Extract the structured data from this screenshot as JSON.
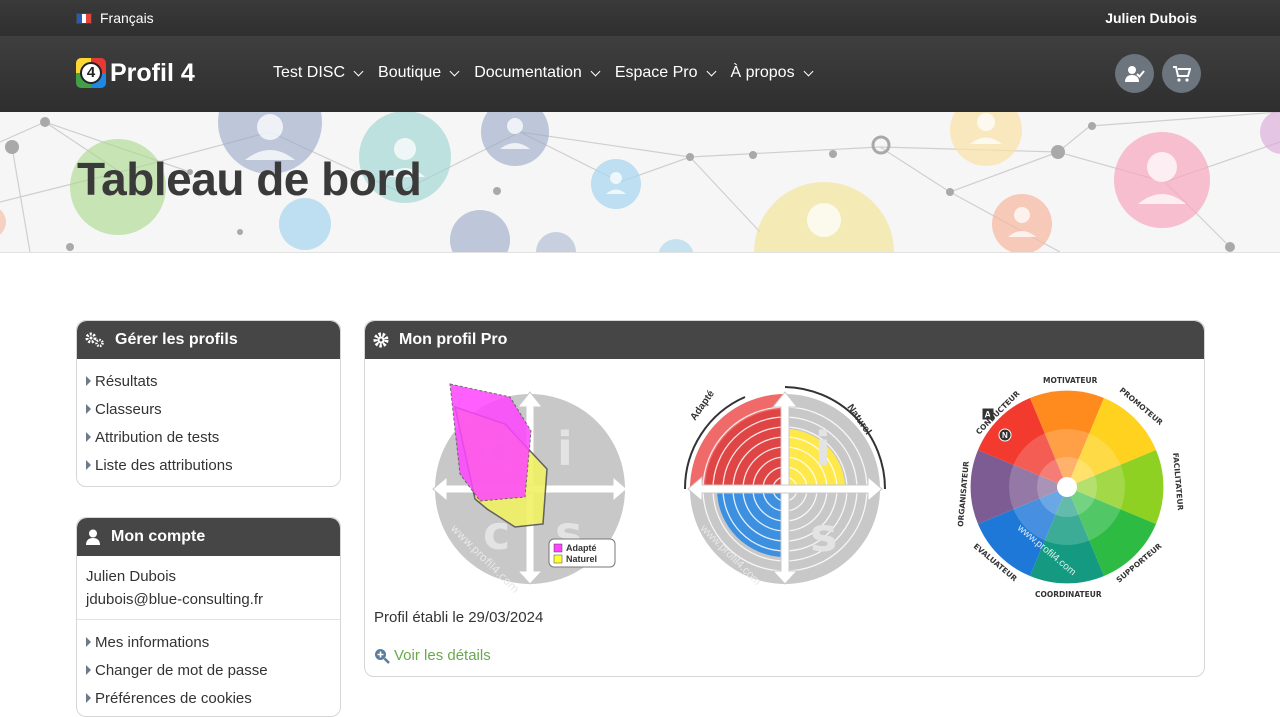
{
  "topbar": {
    "language": "Français",
    "user_name": "Julien Dubois"
  },
  "brand": {
    "logo_digit": "4",
    "name": "Profil 4"
  },
  "nav": {
    "items": [
      "Test DISC",
      "Boutique",
      "Documentation",
      "Espace Pro",
      "À propos"
    ]
  },
  "hero": {
    "title": "Tableau de bord"
  },
  "profiles_panel": {
    "title": "Gérer les profils",
    "items": [
      "Résultats",
      "Classeurs",
      "Attribution de tests",
      "Liste des attributions"
    ]
  },
  "account_panel": {
    "title": "Mon compte",
    "name": "Julien Dubois",
    "email": "jdubois@blue-consulting.fr",
    "items": [
      "Mes informations",
      "Changer de mot de passe",
      "Préférences de cookies"
    ]
  },
  "pro_panel": {
    "title": "Mon profil Pro",
    "date_text": "Profil établi le 29/03/2024",
    "details_link": "Voir les détails",
    "chart1": {
      "letters": [
        "d",
        "i",
        "c",
        "s"
      ],
      "watermark": "www.profil4.com",
      "legend": [
        "Adapté",
        "Naturel"
      ]
    },
    "chart2": {
      "letters": [
        "d",
        "i",
        "c",
        "s"
      ],
      "watermark": "www.profil4.com",
      "arc_left": "Adapté",
      "arc_right": "Naturel"
    },
    "chart3": {
      "labels": [
        "MOTIVATEUR",
        "PROMOTEUR",
        "FACILITATEUR",
        "SUPPORTEUR",
        "COORDINATEUR",
        "EVALUATEUR",
        "ORGANISATEUR",
        "CONDUCTEUR"
      ],
      "marker_a": "A",
      "marker_n": "N",
      "watermark": "www.profil4.com"
    }
  },
  "colors": {
    "dark_header": "#464646",
    "link_green": "#6aa84f",
    "adapte": "#ff44ff",
    "naturel": "#ffff33"
  }
}
